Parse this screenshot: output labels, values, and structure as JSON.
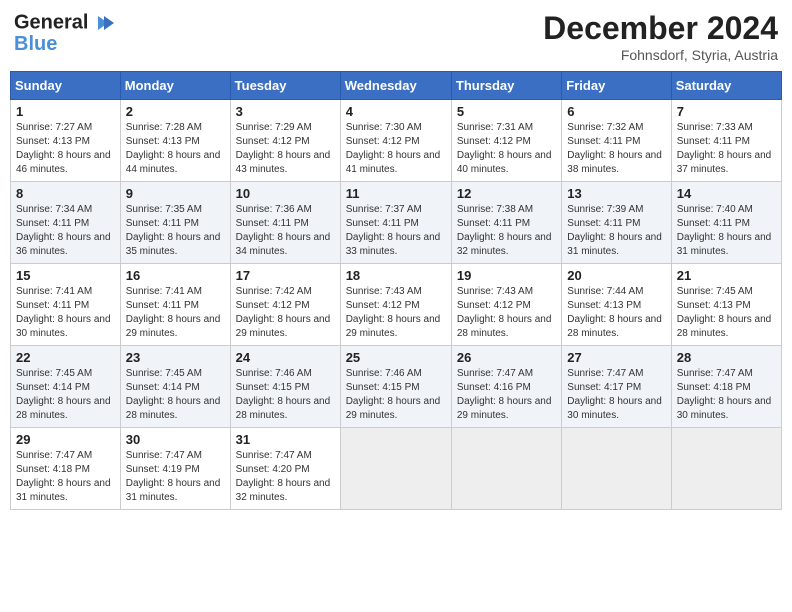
{
  "header": {
    "logo_line1": "General",
    "logo_line2": "Blue",
    "month": "December 2024",
    "location": "Fohnsdorf, Styria, Austria"
  },
  "days_of_week": [
    "Sunday",
    "Monday",
    "Tuesday",
    "Wednesday",
    "Thursday",
    "Friday",
    "Saturday"
  ],
  "weeks": [
    [
      {
        "day": "1",
        "sunrise": "Sunrise: 7:27 AM",
        "sunset": "Sunset: 4:13 PM",
        "daylight": "Daylight: 8 hours and 46 minutes."
      },
      {
        "day": "2",
        "sunrise": "Sunrise: 7:28 AM",
        "sunset": "Sunset: 4:13 PM",
        "daylight": "Daylight: 8 hours and 44 minutes."
      },
      {
        "day": "3",
        "sunrise": "Sunrise: 7:29 AM",
        "sunset": "Sunset: 4:12 PM",
        "daylight": "Daylight: 8 hours and 43 minutes."
      },
      {
        "day": "4",
        "sunrise": "Sunrise: 7:30 AM",
        "sunset": "Sunset: 4:12 PM",
        "daylight": "Daylight: 8 hours and 41 minutes."
      },
      {
        "day": "5",
        "sunrise": "Sunrise: 7:31 AM",
        "sunset": "Sunset: 4:12 PM",
        "daylight": "Daylight: 8 hours and 40 minutes."
      },
      {
        "day": "6",
        "sunrise": "Sunrise: 7:32 AM",
        "sunset": "Sunset: 4:11 PM",
        "daylight": "Daylight: 8 hours and 38 minutes."
      },
      {
        "day": "7",
        "sunrise": "Sunrise: 7:33 AM",
        "sunset": "Sunset: 4:11 PM",
        "daylight": "Daylight: 8 hours and 37 minutes."
      }
    ],
    [
      {
        "day": "8",
        "sunrise": "Sunrise: 7:34 AM",
        "sunset": "Sunset: 4:11 PM",
        "daylight": "Daylight: 8 hours and 36 minutes."
      },
      {
        "day": "9",
        "sunrise": "Sunrise: 7:35 AM",
        "sunset": "Sunset: 4:11 PM",
        "daylight": "Daylight: 8 hours and 35 minutes."
      },
      {
        "day": "10",
        "sunrise": "Sunrise: 7:36 AM",
        "sunset": "Sunset: 4:11 PM",
        "daylight": "Daylight: 8 hours and 34 minutes."
      },
      {
        "day": "11",
        "sunrise": "Sunrise: 7:37 AM",
        "sunset": "Sunset: 4:11 PM",
        "daylight": "Daylight: 8 hours and 33 minutes."
      },
      {
        "day": "12",
        "sunrise": "Sunrise: 7:38 AM",
        "sunset": "Sunset: 4:11 PM",
        "daylight": "Daylight: 8 hours and 32 minutes."
      },
      {
        "day": "13",
        "sunrise": "Sunrise: 7:39 AM",
        "sunset": "Sunset: 4:11 PM",
        "daylight": "Daylight: 8 hours and 31 minutes."
      },
      {
        "day": "14",
        "sunrise": "Sunrise: 7:40 AM",
        "sunset": "Sunset: 4:11 PM",
        "daylight": "Daylight: 8 hours and 31 minutes."
      }
    ],
    [
      {
        "day": "15",
        "sunrise": "Sunrise: 7:41 AM",
        "sunset": "Sunset: 4:11 PM",
        "daylight": "Daylight: 8 hours and 30 minutes."
      },
      {
        "day": "16",
        "sunrise": "Sunrise: 7:41 AM",
        "sunset": "Sunset: 4:11 PM",
        "daylight": "Daylight: 8 hours and 29 minutes."
      },
      {
        "day": "17",
        "sunrise": "Sunrise: 7:42 AM",
        "sunset": "Sunset: 4:12 PM",
        "daylight": "Daylight: 8 hours and 29 minutes."
      },
      {
        "day": "18",
        "sunrise": "Sunrise: 7:43 AM",
        "sunset": "Sunset: 4:12 PM",
        "daylight": "Daylight: 8 hours and 29 minutes."
      },
      {
        "day": "19",
        "sunrise": "Sunrise: 7:43 AM",
        "sunset": "Sunset: 4:12 PM",
        "daylight": "Daylight: 8 hours and 28 minutes."
      },
      {
        "day": "20",
        "sunrise": "Sunrise: 7:44 AM",
        "sunset": "Sunset: 4:13 PM",
        "daylight": "Daylight: 8 hours and 28 minutes."
      },
      {
        "day": "21",
        "sunrise": "Sunrise: 7:45 AM",
        "sunset": "Sunset: 4:13 PM",
        "daylight": "Daylight: 8 hours and 28 minutes."
      }
    ],
    [
      {
        "day": "22",
        "sunrise": "Sunrise: 7:45 AM",
        "sunset": "Sunset: 4:14 PM",
        "daylight": "Daylight: 8 hours and 28 minutes."
      },
      {
        "day": "23",
        "sunrise": "Sunrise: 7:45 AM",
        "sunset": "Sunset: 4:14 PM",
        "daylight": "Daylight: 8 hours and 28 minutes."
      },
      {
        "day": "24",
        "sunrise": "Sunrise: 7:46 AM",
        "sunset": "Sunset: 4:15 PM",
        "daylight": "Daylight: 8 hours and 28 minutes."
      },
      {
        "day": "25",
        "sunrise": "Sunrise: 7:46 AM",
        "sunset": "Sunset: 4:15 PM",
        "daylight": "Daylight: 8 hours and 29 minutes."
      },
      {
        "day": "26",
        "sunrise": "Sunrise: 7:47 AM",
        "sunset": "Sunset: 4:16 PM",
        "daylight": "Daylight: 8 hours and 29 minutes."
      },
      {
        "day": "27",
        "sunrise": "Sunrise: 7:47 AM",
        "sunset": "Sunset: 4:17 PM",
        "daylight": "Daylight: 8 hours and 30 minutes."
      },
      {
        "day": "28",
        "sunrise": "Sunrise: 7:47 AM",
        "sunset": "Sunset: 4:18 PM",
        "daylight": "Daylight: 8 hours and 30 minutes."
      }
    ],
    [
      {
        "day": "29",
        "sunrise": "Sunrise: 7:47 AM",
        "sunset": "Sunset: 4:18 PM",
        "daylight": "Daylight: 8 hours and 31 minutes."
      },
      {
        "day": "30",
        "sunrise": "Sunrise: 7:47 AM",
        "sunset": "Sunset: 4:19 PM",
        "daylight": "Daylight: 8 hours and 31 minutes."
      },
      {
        "day": "31",
        "sunrise": "Sunrise: 7:47 AM",
        "sunset": "Sunset: 4:20 PM",
        "daylight": "Daylight: 8 hours and 32 minutes."
      },
      null,
      null,
      null,
      null
    ]
  ]
}
